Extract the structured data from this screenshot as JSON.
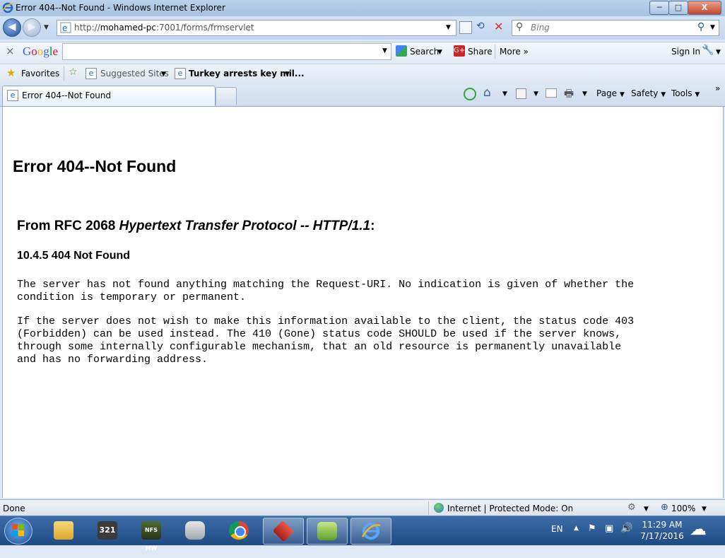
{
  "window": {
    "title": "Error 404--Not Found - Windows Internet Explorer",
    "min": "─",
    "max": "□",
    "close": "X"
  },
  "address": {
    "url_prefix": "http://",
    "url_host": "mohamed-pc",
    "url_rest": ":7001/forms/frmservlet",
    "search_placeholder": "Bing"
  },
  "google_toolbar": {
    "close": "×",
    "logo": [
      "G",
      "o",
      "o",
      "g",
      "l",
      "e"
    ],
    "search_label": "Search",
    "share_label": "Share",
    "more_label": "More »",
    "signin_label": "Sign In"
  },
  "favorites": {
    "favorites_label": "Favorites",
    "suggested_label": "Suggested Sites",
    "news_label": "Turkey arrests key mil..."
  },
  "tabs": {
    "active_label": "Error 404--Not Found"
  },
  "command_bar": {
    "page": "Page",
    "safety": "Safety",
    "tools": "Tools",
    "overflow": "»"
  },
  "page": {
    "heading": "Error 404--Not Found",
    "rfc_prefix": "From RFC 2068 ",
    "rfc_title": "Hypertext Transfer Protocol -- HTTP/1.1",
    "rfc_suffix": ":",
    "section": "10.4.5 404 Not Found",
    "para1": "The server has not found anything matching the Request-URI. No indication is given of whether the\ncondition is temporary or permanent.",
    "para2": "If the server does not wish to make this information available to the client, the status code 403\n(Forbidden) can be used instead. The 410 (Gone) status code SHOULD be used if the server knows,\nthrough some internally configurable mechanism, that an old resource is permanently unavailable\nand has no forwarding address."
  },
  "status": {
    "left": "Done",
    "zone": "Internet | Protected Mode: On",
    "zoom": "100%"
  },
  "taskbar": {
    "lang": "EN",
    "time": "11:29 AM",
    "date": "7/17/2016",
    "badge_321": "321",
    "badge_nfs": "NFS MW"
  },
  "colors": {
    "ie_blue": "#1e66c7",
    "title_bg": "#b9d1ea",
    "taskbar_bg": "#2a5890"
  }
}
